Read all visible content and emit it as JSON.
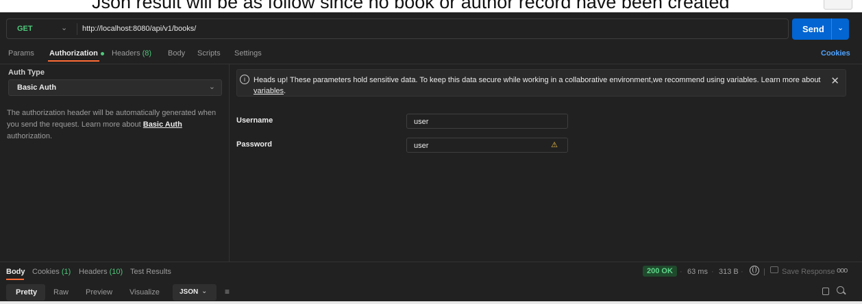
{
  "caption": {
    "text": "Json result will be as follow since no book or author record have been created"
  },
  "request": {
    "method": "GET",
    "url": "http://localhost:8080/api/v1/books/",
    "send_label": "Send"
  },
  "request_tabs": [
    {
      "label": "Params"
    },
    {
      "label": "Authorization"
    },
    {
      "label": "Headers",
      "count": "(8)"
    },
    {
      "label": "Body"
    },
    {
      "label": "Scripts"
    },
    {
      "label": "Settings"
    }
  ],
  "cookies_label": "Cookies",
  "auth": {
    "type_label": "Auth Type",
    "type_value": "Basic Auth",
    "desc_prefix": "The authorization header will be automatically generated when you send the request. Learn more about ",
    "desc_link": "Basic Auth",
    "desc_suffix": " authorization."
  },
  "alert": {
    "text": "Heads up! These parameters hold sensitive data. To keep this data secure while working in a collaborative environment,we recommend using variables. Learn more about ",
    "link": "variables",
    "suffix": "."
  },
  "fields": {
    "username_label": "Username",
    "username_value": "user",
    "password_label": "Password",
    "password_value": "user"
  },
  "response_tabs": [
    {
      "label": "Body"
    },
    {
      "label": "Cookies",
      "count": "(1)"
    },
    {
      "label": "Headers",
      "count": "(10)"
    },
    {
      "label": "Test Results"
    }
  ],
  "response_meta": {
    "status": "200 OK",
    "time": "63 ms",
    "size": "313 B",
    "save_label": "Save Response"
  },
  "formats": {
    "pretty": "Pretty",
    "raw": "Raw",
    "preview": "Preview",
    "visualize": "Visualize",
    "json": "JSON"
  },
  "colors": {
    "accent": "#ff6c37",
    "send": "#0265d2",
    "success": "#4ec97b",
    "link": "#4fa3ff"
  }
}
